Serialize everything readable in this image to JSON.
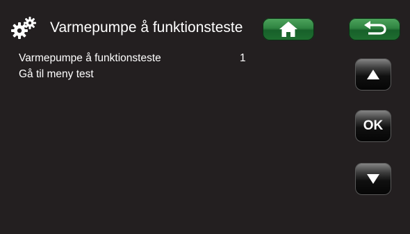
{
  "header": {
    "title": "Varmepumpe å funktionsteste",
    "settings_icon": "gears-icon",
    "home_icon": "home-icon",
    "back_icon": "back-arrow-icon"
  },
  "content": {
    "rows": [
      {
        "label": "Varmepumpe å funktionsteste",
        "value": "1"
      },
      {
        "label": "Gå til meny test"
      }
    ]
  },
  "nav": {
    "up_icon": "triangle-up-icon",
    "ok_label": "OK",
    "down_icon": "triangle-down-icon"
  },
  "colors": {
    "background": "#231f20",
    "accent_green": "#2f8441",
    "text": "#ffffff"
  }
}
